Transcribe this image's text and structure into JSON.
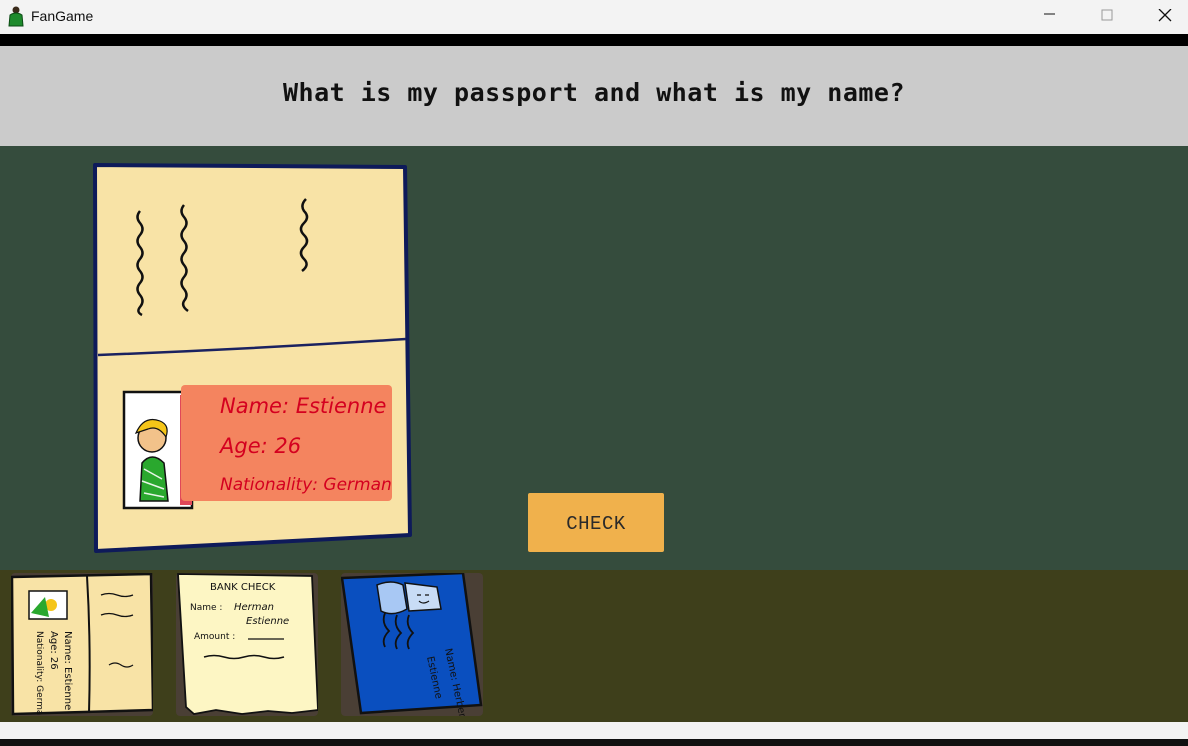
{
  "window": {
    "title": "FanGame",
    "icons": {
      "app": "green-figure-icon",
      "minimize": "minimize-icon",
      "maximize": "maximize-icon",
      "close": "close-icon"
    }
  },
  "question": "What is my passport and what is my name?",
  "passport": {
    "name_line": "Name: Estienne",
    "age_line": "Age: 26",
    "nationality_line": "Nationality: German"
  },
  "check_button": {
    "label": "CHECK"
  },
  "inventory": {
    "items": [
      {
        "kind": "passport-card",
        "name_line": "Name: Estienne",
        "age_line": "Age: 26",
        "nationality_line": "Nationality: German"
      },
      {
        "kind": "bank-check",
        "header": "BANK CHECK",
        "name_label": "Name :",
        "name_line1": "Herman",
        "name_line2": "Estienne",
        "amount_label": "Amount :"
      },
      {
        "kind": "blue-card",
        "text_line1": "Name: Herbert",
        "text_line2": "Estienne"
      }
    ]
  },
  "colors": {
    "desk": "#354c3d",
    "question_bar": "#cbcbcb",
    "inventory_bar": "#3e3f1b",
    "button": "#f0b14c",
    "passport_paper": "#f8e3a6",
    "info_box": "#f4845f",
    "ink_red": "#d4001f"
  }
}
